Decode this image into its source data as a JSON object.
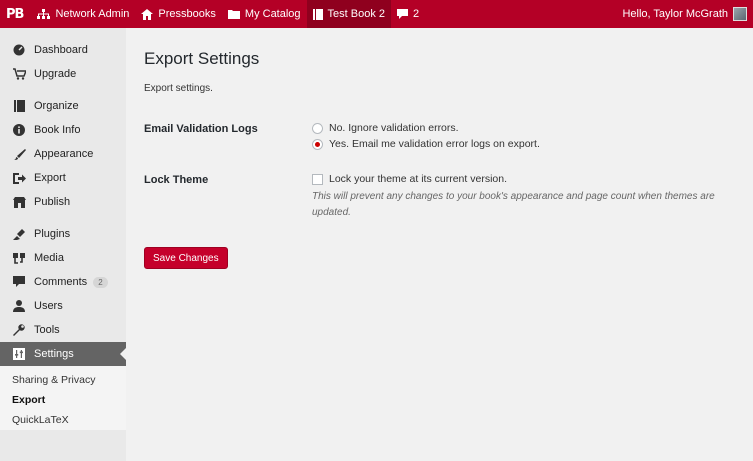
{
  "adminbar": {
    "logo": "PB",
    "network_admin": "Network Admin",
    "pressbooks": "Pressbooks",
    "my_catalog": "My Catalog",
    "book": "Test Book 2",
    "comments_count": "2",
    "greeting": "Hello, Taylor McGrath"
  },
  "sidebar": {
    "items": [
      {
        "label": "Dashboard",
        "icon": "dashboard-icon"
      },
      {
        "label": "Upgrade",
        "icon": "cart-icon"
      },
      {
        "label": "Organize",
        "icon": "book-icon"
      },
      {
        "label": "Book Info",
        "icon": "info-icon"
      },
      {
        "label": "Appearance",
        "icon": "paintbrush-icon"
      },
      {
        "label": "Export",
        "icon": "export-icon"
      },
      {
        "label": "Publish",
        "icon": "store-icon"
      },
      {
        "label": "Plugins",
        "icon": "plugin-icon"
      },
      {
        "label": "Media",
        "icon": "media-icon"
      },
      {
        "label": "Comments",
        "icon": "comment-icon",
        "badge": "2"
      },
      {
        "label": "Users",
        "icon": "users-icon"
      },
      {
        "label": "Tools",
        "icon": "wrench-icon"
      },
      {
        "label": "Settings",
        "icon": "settings-icon"
      }
    ],
    "submenu": [
      "Sharing & Privacy",
      "Export",
      "QuickLaTeX"
    ]
  },
  "main": {
    "title": "Export Settings",
    "description": "Export settings.",
    "email_validation": {
      "label": "Email Validation Logs",
      "option_no": "No. Ignore validation errors.",
      "option_yes": "Yes. Email me validation error logs on export.",
      "selected": "yes"
    },
    "lock_theme": {
      "label": "Lock Theme",
      "checkbox_label": "Lock your theme at its current version.",
      "checked": false,
      "help": "This will prevent any changes to your book's appearance and page count when themes are updated."
    },
    "save_label": "Save Changes"
  },
  "colors": {
    "brand": "#b40026",
    "button": "#c5002b",
    "sidebar_bg": "#e9e9e9",
    "current_menu": "#646464"
  }
}
